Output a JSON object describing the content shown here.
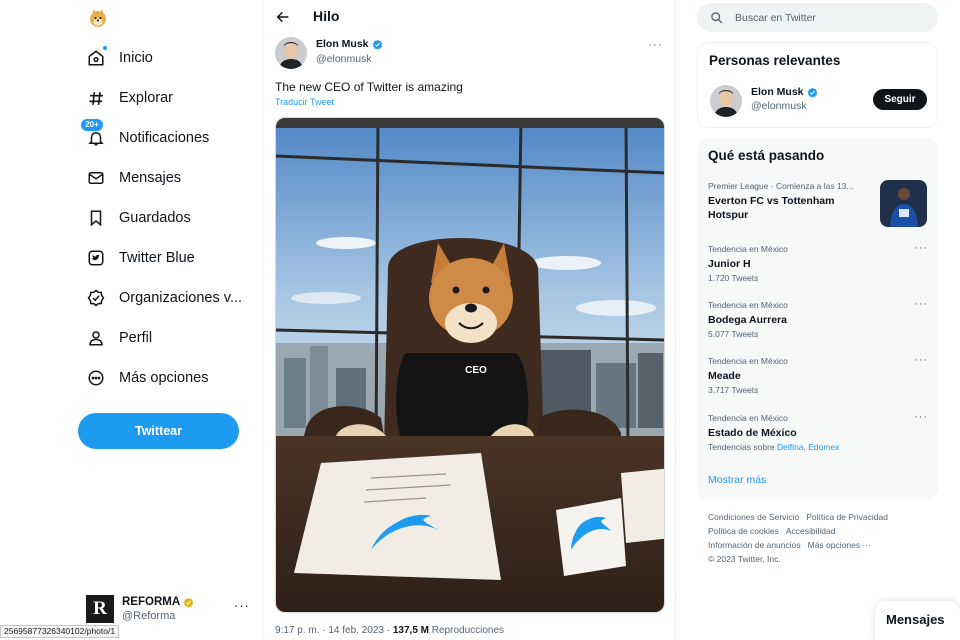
{
  "brand": {
    "accent": "#1d9bf0",
    "text": "#0f1419",
    "muted": "#536471",
    "verified": "#1d9bf0",
    "gold_verified": "#e2b719"
  },
  "sidebar": {
    "logo_icon": "doge-logo-icon",
    "items": [
      {
        "label": "Inicio",
        "icon": "home-icon"
      },
      {
        "label": "Explorar",
        "icon": "hashtag-icon"
      },
      {
        "label": "Notificaciones",
        "icon": "bell-icon",
        "badge": "20+"
      },
      {
        "label": "Mensajes",
        "icon": "envelope-icon"
      },
      {
        "label": "Guardados",
        "icon": "bookmark-icon"
      },
      {
        "label": "Twitter Blue",
        "icon": "twitter-blue-icon"
      },
      {
        "label": "Organizaciones v...",
        "icon": "verified-org-icon"
      },
      {
        "label": "Perfil",
        "icon": "person-icon"
      },
      {
        "label": "Más opciones",
        "icon": "more-circle-icon"
      }
    ],
    "tweet_button": "Twittear",
    "account": {
      "name": "REFORMA",
      "handle": "@Reforma",
      "avatar_letter": "R",
      "more": "···"
    }
  },
  "status_bar_url": "25695877326340102/photo/1",
  "thread": {
    "title": "Hilo",
    "author": {
      "name": "Elon Musk",
      "handle": "@elonmusk"
    },
    "more": "···",
    "text": "The new CEO of Twitter is amazing",
    "translate": "Traducir Tweet",
    "photo": {
      "sweater_text": "CEO"
    },
    "meta": {
      "time": "9:17 p. m. · 14 feb. 2023 · ",
      "views": "137,5 M",
      "views_label": " Reproducciones"
    }
  },
  "right": {
    "search_placeholder": "Buscar en Twitter",
    "relevant": {
      "title": "Personas relevantes",
      "person": {
        "name": "Elon Musk",
        "handle": "@elonmusk"
      },
      "follow": "Seguir"
    },
    "trends": {
      "title": "Qué está pasando",
      "items": [
        {
          "context": "Premier League · Comienza a las 13...",
          "name": "Everton FC vs Tottenham Hotspur",
          "count": ""
        },
        {
          "context": "Tendencia en México",
          "name": "Junior H",
          "count": "1.720 Tweets"
        },
        {
          "context": "Tendencia en México",
          "name": "Bodega Aurrera",
          "count": "5.077 Tweets"
        },
        {
          "context": "Tendencia en México",
          "name": "Meade",
          "count": "3.717 Tweets"
        },
        {
          "context": "Tendencia en México",
          "name": "Estado de México",
          "count_prefix": "Tendencias sobre ",
          "link1": "Delfina",
          "sep": ", ",
          "link2": "Edomex"
        }
      ],
      "more_label": "···",
      "show_more": "Mostrar más"
    },
    "footer": {
      "links": [
        "Condiciones de Servicio",
        "Política de Privacidad",
        "Política de cookies",
        "Accesibilidad",
        "Información de anuncios",
        "Más opciones ···"
      ],
      "copyright": "© 2023 Twitter, Inc."
    }
  },
  "messages_drawer": "Mensajes"
}
